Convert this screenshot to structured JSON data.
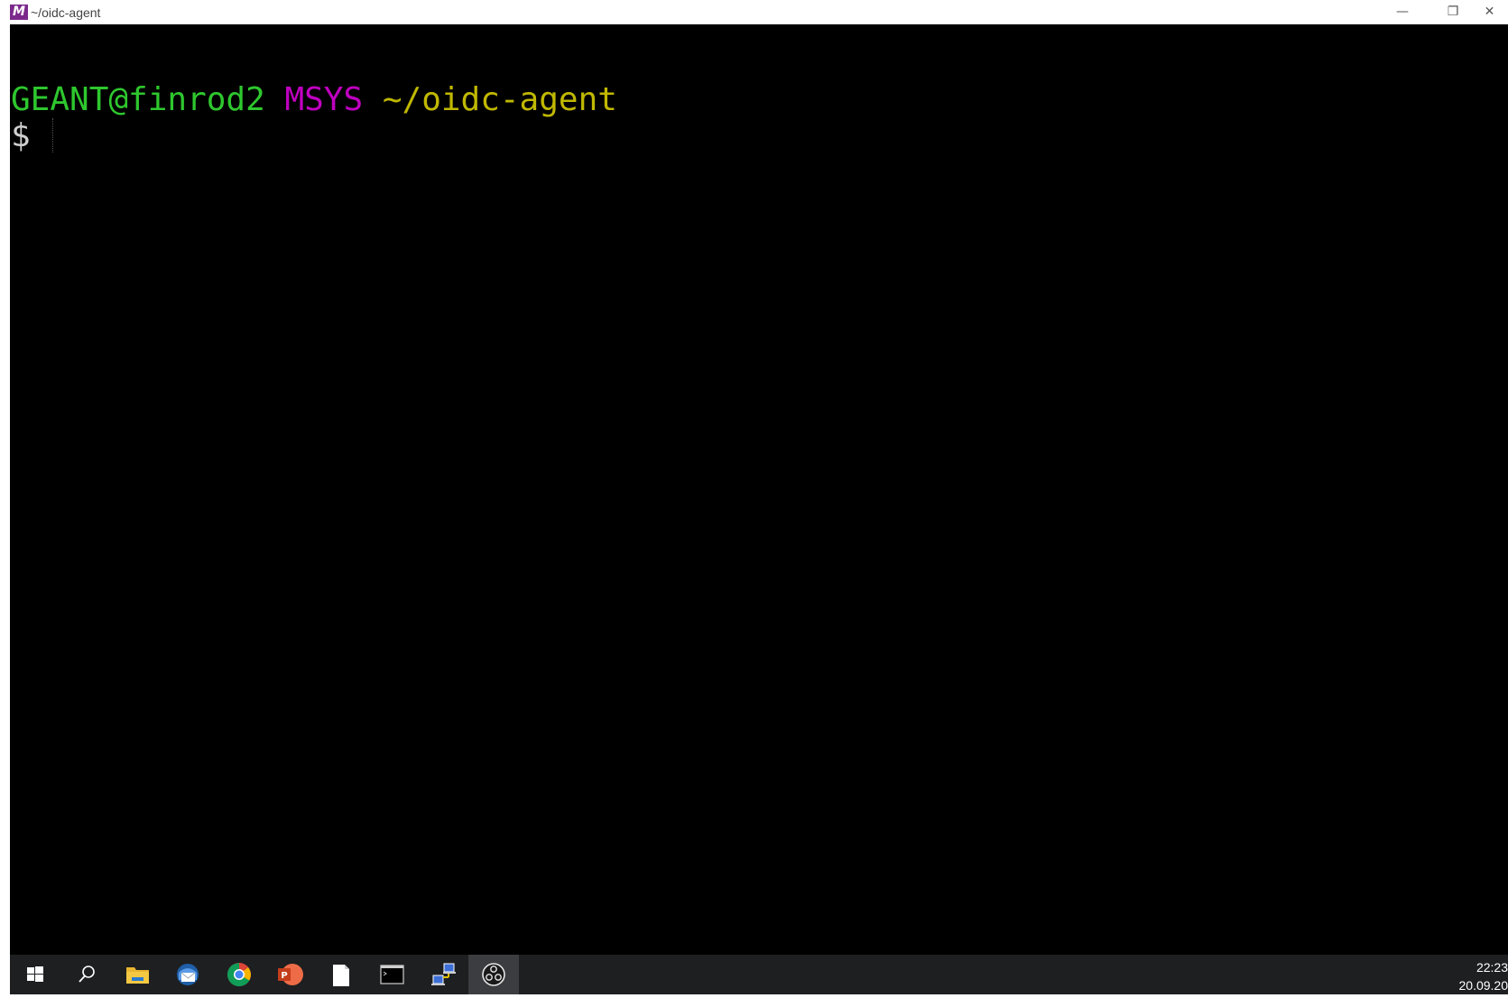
{
  "window": {
    "title": "~/oidc-agent",
    "app_icon_letter": "M",
    "minimize_glyph": "—",
    "restore_glyph": "❐",
    "close_glyph": "✕"
  },
  "terminal": {
    "prompt": {
      "user_host": "GEANT@finrod2",
      "system": "MSYS",
      "path": "~/oidc-agent",
      "symbol": "$"
    },
    "colors": {
      "background": "#000000",
      "user_host": "#2ec72e",
      "system": "#c000c0",
      "path": "#c0b800",
      "symbol": "#cfcfcf"
    }
  },
  "taskbar": {
    "items": [
      {
        "icon": "windows-start-icon",
        "active": false
      },
      {
        "icon": "search-icon",
        "active": false
      },
      {
        "icon": "file-explorer-icon",
        "active": false
      },
      {
        "icon": "thunderbird-mail-icon",
        "active": false
      },
      {
        "icon": "chrome-icon",
        "active": false
      },
      {
        "icon": "powerpoint-icon",
        "active": false
      },
      {
        "icon": "blank-document-icon",
        "active": false
      },
      {
        "icon": "terminal-icon",
        "active": false
      },
      {
        "icon": "network-connection-icon",
        "active": false
      },
      {
        "icon": "obs-studio-icon",
        "active": true
      }
    ],
    "clock": {
      "time": "22:23",
      "date": "20.09.20"
    }
  }
}
